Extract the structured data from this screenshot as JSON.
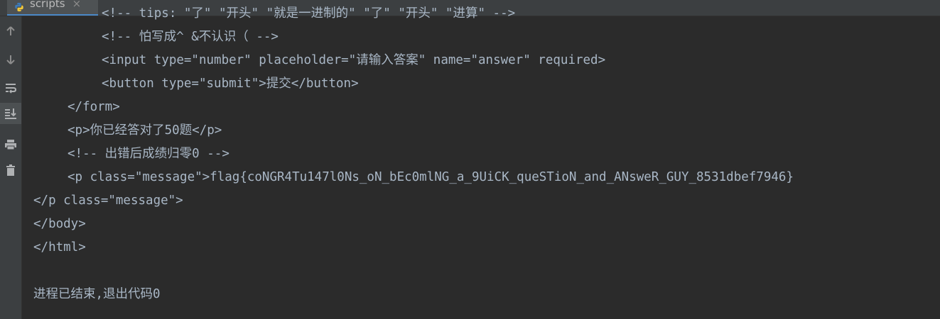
{
  "tab": {
    "label": "scripts",
    "close_glyph": "×",
    "icon": "python-icon"
  },
  "toolbar": {
    "tools": [
      {
        "name": "up-arrow-icon",
        "title": "Up"
      },
      {
        "name": "down-arrow-icon",
        "title": "Down"
      },
      {
        "name": "soft-wrap-icon",
        "title": "Soft-wrap"
      },
      {
        "name": "scroll-to-end-icon",
        "title": "Scroll to end"
      },
      {
        "name": "print-icon",
        "title": "Print"
      },
      {
        "name": "trash-icon",
        "title": "Clear all"
      }
    ]
  },
  "console": {
    "lines": [
      "<!-- tips: \"了\" \"开头\" \"就是一进制的\" \"了\" \"开头\" \"进算\" -->",
      "<!-- 怕写成^ &不认识（ -->",
      "<input type=\"number\" placeholder=\"请输入答案\" name=\"answer\" required>",
      "<button type=\"submit\">提交</button>",
      "</form>",
      "<p>你已经答对了50题</p>",
      "<!-- 出错后成绩归零0 -->",
      "<p class=\"message\">flag{coNGR4Tu147l0Ns_oN_bEc0mlNG_a_9UiCK_queSTioN_and_ANsweR_GUY_8531dbef7946}",
      "</p class=\"message\">",
      "</body>",
      "</html>",
      "进程已结束,退出代码0"
    ]
  },
  "colors": {
    "background": "#2b2b2b",
    "text": "#a9b7c6",
    "toolbar": "#3c3f41",
    "tab_underline": "#4a88c7"
  }
}
